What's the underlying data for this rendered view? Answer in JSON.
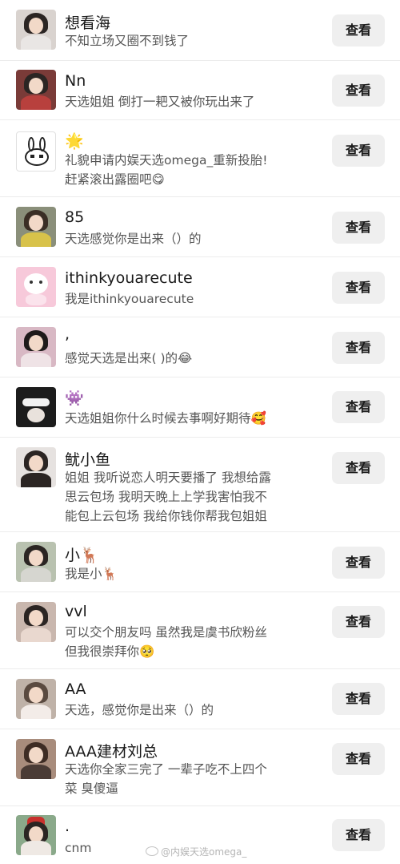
{
  "view_button_label": "查看",
  "watermark": "@内娱天选omega_",
  "items": [
    {
      "name": "想看海",
      "message_lines": [
        "不知立场又圈不到钱了"
      ],
      "avatar_bg": "#d9d3cf"
    },
    {
      "name": "Nn",
      "message_lines": [
        "天选姐姐 倒打一耙又被你玩出来了"
      ],
      "avatar_bg": "#7a3b38"
    },
    {
      "name": "🌟",
      "message_lines": [
        "礼貌申请内娱天选omega_重新投胎!",
        "赶紧滚出露圈吧😋"
      ],
      "avatar_bg": "#ffffff"
    },
    {
      "name": "85",
      "message_lines": [
        "天选感觉你是出来（）的"
      ],
      "avatar_bg": "#8a8f7a"
    },
    {
      "name": "ithinkyouarecute",
      "message_lines": [
        "我是ithinkyouarecute"
      ],
      "avatar_bg": "#f7c9da"
    },
    {
      "name": ",",
      "message_lines": [
        "感觉天选是出来( )的😂"
      ],
      "avatar_bg": "#d8b8c4"
    },
    {
      "name": "👾",
      "message_lines": [
        "天选姐姐你什么时候去事啊好期待🥰"
      ],
      "avatar_bg": "#1c1c1c"
    },
    {
      "name": "鱿小鱼",
      "message_lines": [
        "姐姐 我听说恋人明天要播了 我想给露",
        "思云包场 我明天晚上上学我害怕我不",
        "能包上云包场 我给你钱你帮我包姐姐"
      ],
      "avatar_bg": "#e6e2e0"
    },
    {
      "name": "小🦌",
      "message_lines": [
        "我是小🦌"
      ],
      "avatar_bg": "#b9c2b0"
    },
    {
      "name": "vvl",
      "message_lines": [
        "可以交个朋友吗 虽然我是虞书欣粉丝",
        "但我很崇拜你🥺"
      ],
      "avatar_bg": "#c9b7ae"
    },
    {
      "name": "AA",
      "message_lines": [
        "天选，感觉你是出来（）的"
      ],
      "avatar_bg": "#bfb2a8"
    },
    {
      "name": "AAA建材刘总",
      "message_lines": [
        "天选你全家三完了 一辈子吃不上四个",
        "菜 臭傻逼"
      ],
      "avatar_bg": "#a88c7c"
    },
    {
      "name": ".",
      "message_lines": [
        "cnm"
      ],
      "avatar_bg": "#8aa98a"
    }
  ]
}
